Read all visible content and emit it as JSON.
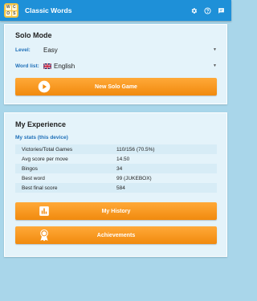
{
  "app": {
    "title": "Classic Words",
    "logo_letters": [
      "W",
      "C",
      "O",
      "S"
    ]
  },
  "toolbar": {
    "icons": [
      "settings-icon",
      "help-icon",
      "chat-icon"
    ]
  },
  "solo": {
    "title": "Solo Mode",
    "level_label": "Level:",
    "level_value": "Easy",
    "wordlist_label": "Word list:",
    "wordlist_value": "English",
    "new_game_label": "New Solo Game"
  },
  "experience": {
    "title": "My Experience",
    "stats_label": "My stats (this device)",
    "stats": [
      {
        "key": "Victories/Total Games",
        "value": "110/156 (70.5%)"
      },
      {
        "key": "Avg score per move",
        "value": "14.50"
      },
      {
        "key": "Bingos",
        "value": "34"
      },
      {
        "key": "Best word",
        "value": "99 (JUKEBOX)"
      },
      {
        "key": "Best final score",
        "value": "584"
      }
    ],
    "history_label": "My History",
    "achievements_label": "Achievements"
  },
  "colors": {
    "appbar": "#1e90d8",
    "accent": "#f18a0e",
    "label_blue": "#1e6fb8",
    "background": "#a9d6ea"
  }
}
